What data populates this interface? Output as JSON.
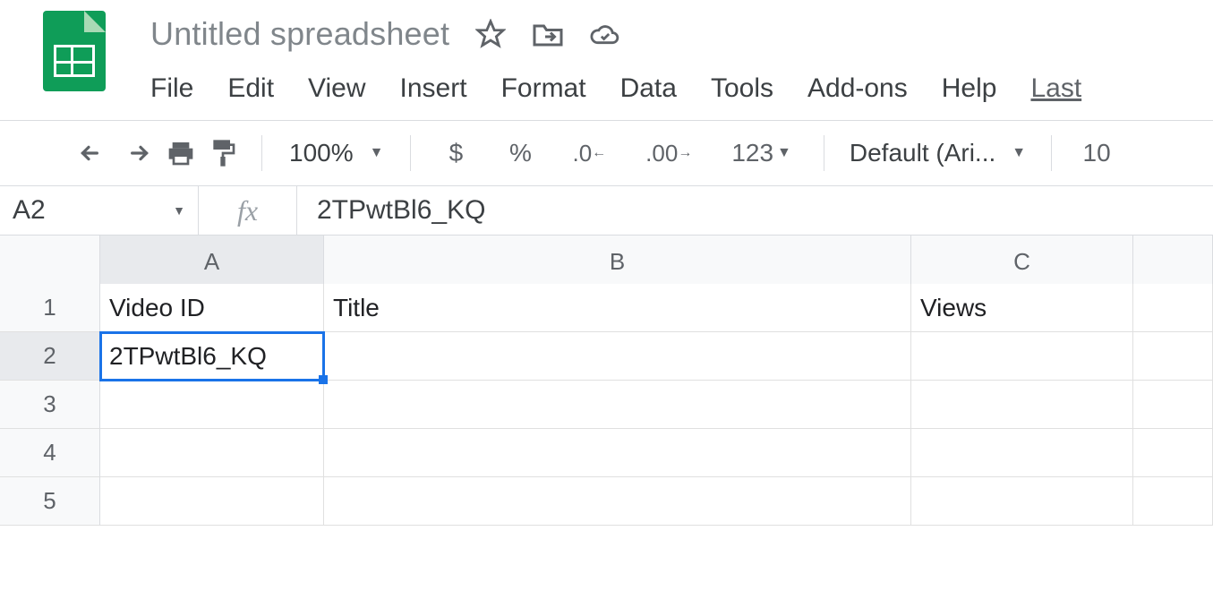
{
  "header": {
    "doc_title": "Untitled spreadsheet",
    "menubar": {
      "file": "File",
      "edit": "Edit",
      "view": "View",
      "insert": "Insert",
      "format": "Format",
      "data": "Data",
      "tools": "Tools",
      "addons": "Add-ons",
      "help": "Help",
      "last": "Last"
    }
  },
  "toolbar": {
    "zoom": "100%",
    "currency": "$",
    "percent": "%",
    "decrease_decimal": ".0",
    "increase_decimal": ".00",
    "number_format": "123",
    "font_name": "Default (Ari...",
    "font_size": "10"
  },
  "fx": {
    "name_box": "A2",
    "fx_label": "fx",
    "formula": "2TPwtBl6_KQ"
  },
  "grid": {
    "columns": [
      "A",
      "B",
      "C"
    ],
    "rows": [
      "1",
      "2",
      "3",
      "4",
      "5"
    ],
    "data": {
      "A1": "Video ID",
      "B1": "Title",
      "C1": "Views",
      "A2": "2TPwtBl6_KQ"
    },
    "selected": "A2"
  }
}
